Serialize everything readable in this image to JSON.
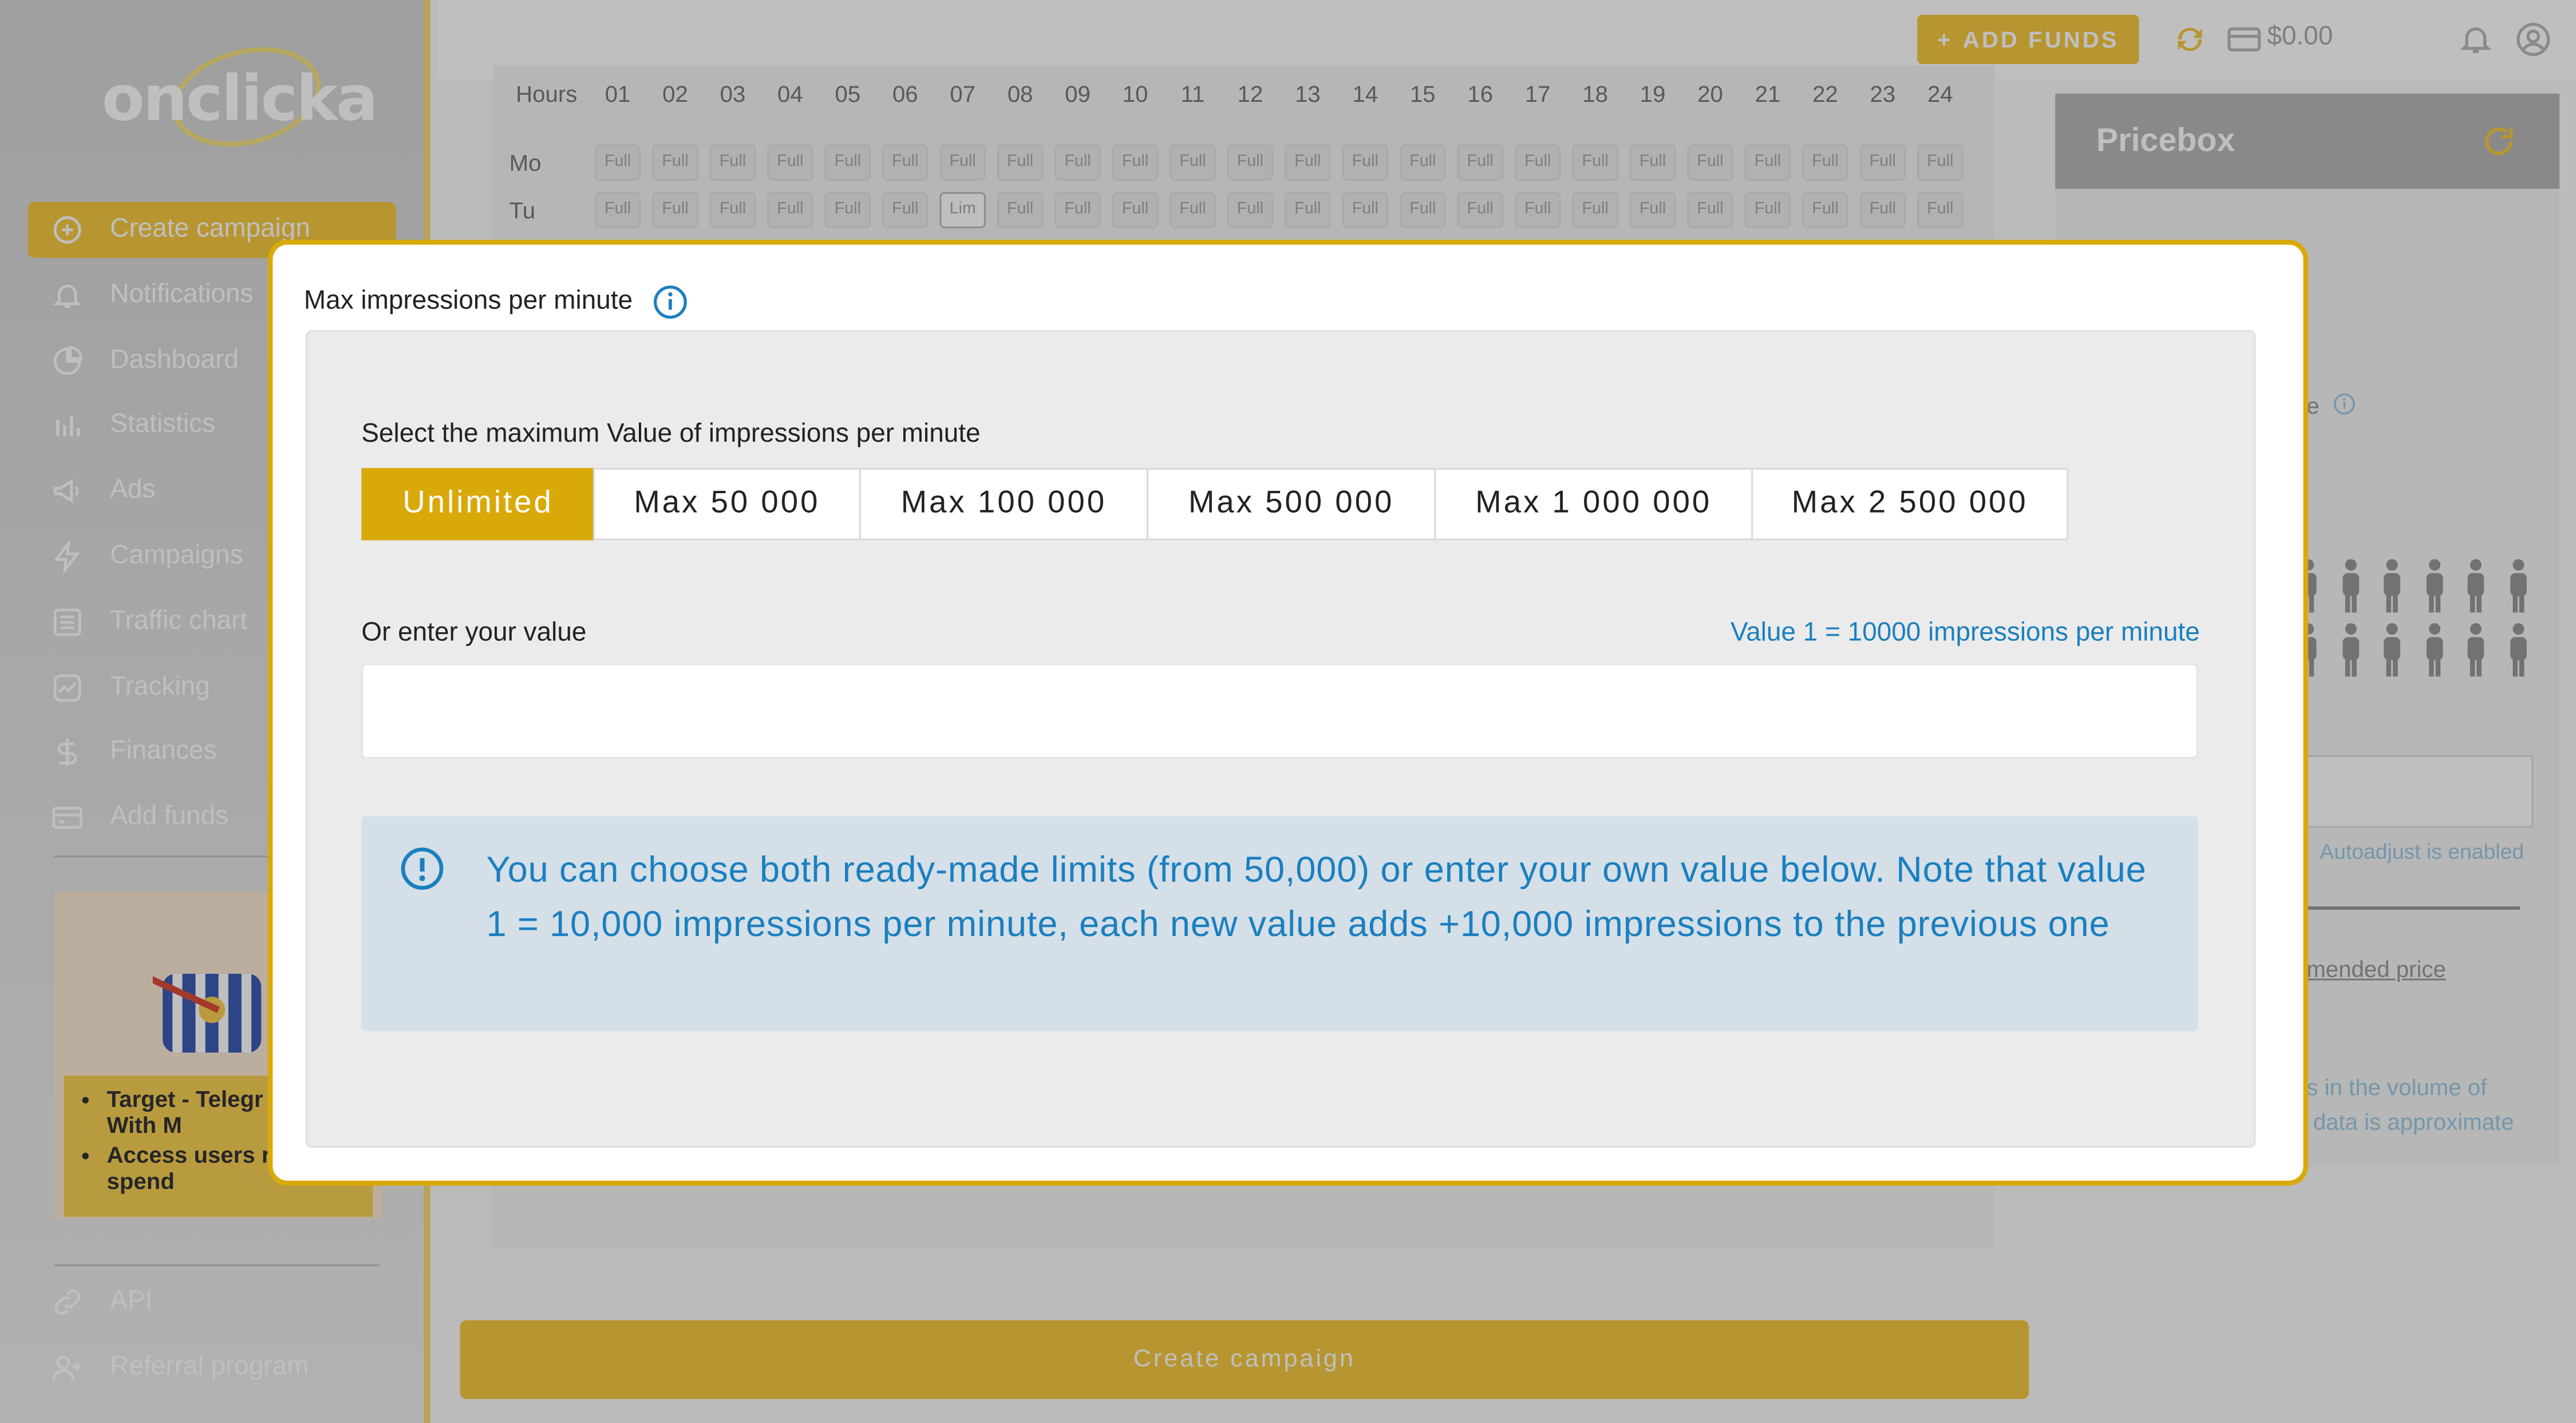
{
  "sidebar": {
    "logo": "onclicka",
    "items": [
      {
        "label": "Create campaign",
        "icon": "plus-circle-icon"
      },
      {
        "label": "Notifications",
        "icon": "bell-icon"
      },
      {
        "label": "Dashboard",
        "icon": "pie-chart-icon"
      },
      {
        "label": "Statistics",
        "icon": "bar-chart-icon"
      },
      {
        "label": "Ads",
        "icon": "megaphone-icon"
      },
      {
        "label": "Campaigns",
        "icon": "lightning-icon"
      },
      {
        "label": "Traffic chart",
        "icon": "list-icon"
      },
      {
        "label": "Tracking",
        "icon": "trend-icon"
      },
      {
        "label": "Finances",
        "icon": "dollar-icon"
      },
      {
        "label": "Add funds",
        "icon": "card-icon"
      }
    ],
    "promo": {
      "bullets": [
        "Target - Telegr Wallet With M",
        "Access users r to spend"
      ]
    },
    "bottom_items": [
      {
        "label": "API",
        "icon": "link-icon"
      },
      {
        "label": "Referral program",
        "icon": "user-plus-icon"
      }
    ]
  },
  "topbar": {
    "add_funds": "ADD FUNDS",
    "balance": "$0.00"
  },
  "schedule": {
    "hours_label": "Hours",
    "hours": [
      "01",
      "02",
      "03",
      "04",
      "05",
      "06",
      "07",
      "08",
      "09",
      "10",
      "11",
      "12",
      "13",
      "14",
      "15",
      "16",
      "17",
      "18",
      "19",
      "20",
      "21",
      "22",
      "23",
      "24"
    ],
    "days": [
      {
        "label": "Mo",
        "cells": [
          "Full",
          "Full",
          "Full",
          "Full",
          "Full",
          "Full",
          "Full",
          "Full",
          "Full",
          "Full",
          "Full",
          "Full",
          "Full",
          "Full",
          "Full",
          "Full",
          "Full",
          "Full",
          "Full",
          "Full",
          "Full",
          "Full",
          "Full",
          "Full"
        ]
      },
      {
        "label": "Tu",
        "cells": [
          "Full",
          "Full",
          "Full",
          "Full",
          "Full",
          "Full",
          "Lim",
          "Full",
          "Full",
          "Full",
          "Full",
          "Full",
          "Full",
          "Full",
          "Full",
          "Full",
          "Full",
          "Full",
          "Full",
          "Full",
          "Full",
          "Full",
          "Full",
          "Full"
        ]
      }
    ]
  },
  "pricebox": {
    "title": "Pricebox",
    "peek_e": "e",
    "autoadjust": "Autoadjust is enabled",
    "recommended": "mended price",
    "volume_note_1": "s in the volume of",
    "volume_note_2": "data is approximate"
  },
  "create_campaign_button": "Create campaign",
  "modal": {
    "title": "Max impressions per minute",
    "select_label": "Select the maximum Value of impressions per minute",
    "limits": [
      "Unlimited",
      "Max 50 000",
      "Max 100 000",
      "Max 500 000",
      "Max 1 000 000",
      "Max 2 500 000"
    ],
    "selected_limit": "Unlimited",
    "enter_label": "Or enter your value",
    "value_hint": "Value 1 = 10000 impressions per minute",
    "input_value": "",
    "input_placeholder": "",
    "notice": "You can choose both ready-made limits (from 50,000) or enter your own value below. Note that value 1 = 10,000 impressions per minute, each new value adds +10,000 impressions to the previous one"
  },
  "colors": {
    "accent": "#f5c842",
    "modal_accent": "#d9a90a",
    "info_blue": "#1a7fc0",
    "notice_bg": "#d5dfe7"
  }
}
